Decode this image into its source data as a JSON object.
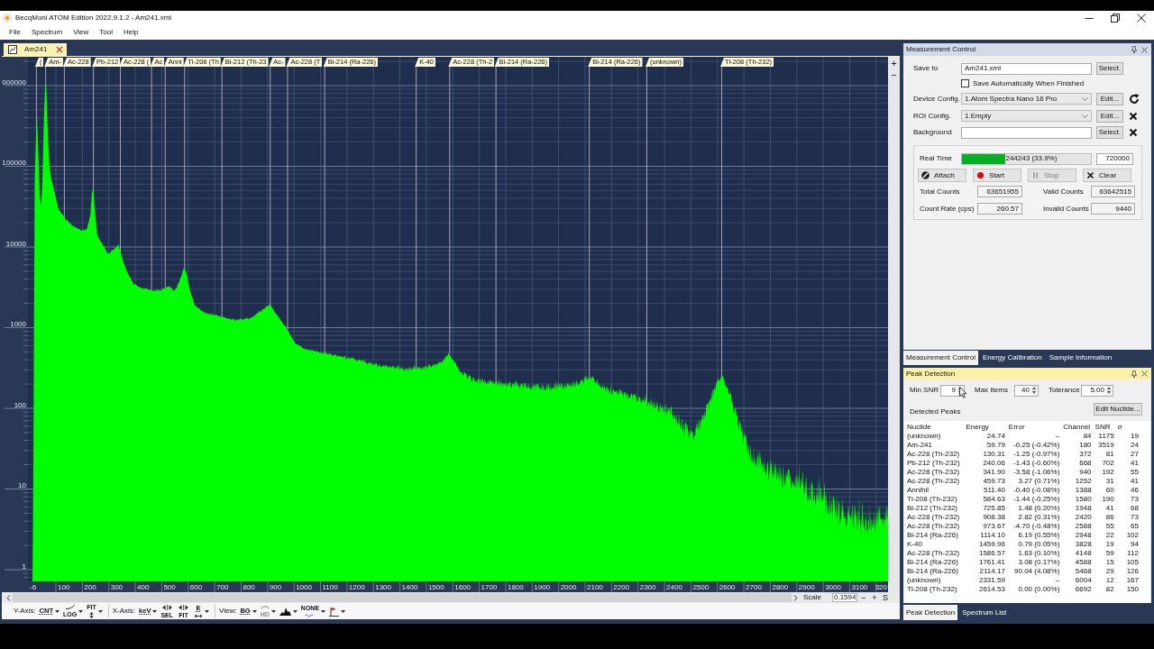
{
  "window": {
    "title": "BecqMoni ATOM Edition 2022.9.1.2 - Am241.xml"
  },
  "menu": [
    "File",
    "Spectrum",
    "View",
    "Tool",
    "Help"
  ],
  "document_tabs": [
    {
      "label": "Am241",
      "selected": true
    }
  ],
  "spectrum": {
    "peak_labels": [
      "(",
      "Am-",
      "Ac-228",
      "Pb-212",
      "Ac-228 (",
      "Ac",
      "Anni",
      "Tl-208 (Th",
      "Bi-212 (Th-23",
      "Ac-",
      "Ac-228 (T",
      "Bi-214 (Ra-226)",
      "K-40",
      "Ac-228 (Th-2",
      "Bi-214 (Ra-226)",
      "Bi-214 (Ra-226)",
      "(unknown)",
      "Tl-208 (Th-232)"
    ],
    "y_axis_labels": [
      "000000",
      "100000",
      "10000",
      "1000",
      "100",
      "10",
      "1"
    ],
    "x_axis_labels": [
      "-6",
      "100",
      "200",
      "300",
      "400",
      "500",
      "600",
      "700",
      "800",
      "900",
      "1000",
      "1100",
      "1200",
      "1300",
      "1400",
      "1500",
      "1600",
      "1700",
      "1800",
      "1900",
      "2000",
      "2100",
      "2200",
      "2300",
      "2400",
      "2500",
      "2600",
      "2700",
      "2800",
      "2900",
      "3000",
      "3100",
      "320"
    ],
    "zoom_buttons": [
      "+",
      "−"
    ]
  },
  "scroll_bar": {
    "scale_label": "Scale",
    "scale_value": "0.1594",
    "buttons": [
      "−",
      "+",
      "S"
    ]
  },
  "chart_toolbar": [
    {
      "label": "Y-Axis:",
      "tools": [
        {
          "kind": "text",
          "text": "CNT",
          "dropdown": true,
          "disabled": false
        },
        {
          "kind": "curve",
          "text": "LOG",
          "dropdown": true,
          "disabled": false
        },
        {
          "kind": "vertical-arrows",
          "text": "FIT",
          "dropdown": true,
          "disabled": false
        }
      ]
    },
    {
      "label": "X-Axis:",
      "tools": [
        {
          "kind": "text",
          "text": "keV",
          "dropdown": true,
          "disabled": false
        },
        {
          "kind": "horizontal-arrows",
          "text": "SEL",
          "dropdown": false,
          "disabled": false
        },
        {
          "kind": "horizontal-arrows",
          "text": "FIT",
          "dropdown": false,
          "disabled": false
        },
        {
          "kind": "over-arrow",
          "text": "E",
          "dropdown": true,
          "disabled": false
        }
      ]
    },
    {
      "label": "View:",
      "tools": [
        {
          "kind": "text",
          "text": "BG",
          "dropdown": true,
          "disabled": false
        },
        {
          "kind": "arc",
          "text": "HD",
          "dropdown": true,
          "disabled": true
        },
        {
          "kind": "mountain",
          "dropdown": true,
          "disabled": false
        },
        {
          "kind": "wave",
          "text": "NONE",
          "dropdown": true,
          "disabled": false
        },
        {
          "kind": "flag",
          "dropdown": true,
          "disabled": false
        }
      ]
    }
  ],
  "measurement_control": {
    "title": "Measurement Control",
    "active": false,
    "rows": [
      {
        "kind": "input",
        "label": "Save to",
        "value": "Am241.xml",
        "button": "Select."
      },
      {
        "kind": "checkbox",
        "label": "Save Automatically When Finished",
        "checked": false
      },
      {
        "kind": "select",
        "label": "Device Config.",
        "value": "1.Atom Spectra Nano 16 Pro",
        "button": "Edit...",
        "side_button": {
          "kind": "reload"
        }
      },
      {
        "kind": "select",
        "label": "ROI Config.",
        "value": "1.Empty",
        "button": "Edit...",
        "side_button": {
          "kind": "remove"
        }
      },
      {
        "kind": "input",
        "label": "Background",
        "button": "Select.",
        "side_button": {
          "kind": "remove"
        }
      }
    ],
    "real_time": {
      "label": "Real Time",
      "level": 0.339,
      "progress_text": "244243 (33.9%)",
      "limit": "720000"
    },
    "buttons": [
      {
        "kind": "attach",
        "label": "Attach",
        "disabled": false
      },
      {
        "kind": "start",
        "label": "Start",
        "disabled": false
      },
      {
        "kind": "stop",
        "label": "Stop",
        "disabled": true
      },
      {
        "kind": "clear",
        "label": "Clear",
        "disabled": false
      }
    ],
    "stats": [
      {
        "label": "Total Counts",
        "value": "63651955"
      },
      {
        "label": "Valid Counts",
        "value": "63642515"
      },
      {
        "label": "Count Rate (cps)",
        "value": "260.57"
      },
      {
        "label": "Invalid Counts",
        "value": "9440"
      }
    ]
  },
  "panel_tabs": [
    {
      "label": "Measurement Control",
      "selected": true
    },
    {
      "label": "Energy Calibration",
      "selected": false
    },
    {
      "label": "Sample Information",
      "selected": false
    }
  ],
  "peak_detection": {
    "title": "Peak Detection",
    "active": true,
    "settings": [
      {
        "label": "Min SNR",
        "value": "9"
      },
      {
        "label": "Max Items",
        "value": "40"
      },
      {
        "label": "Tolerance",
        "value": "5.00"
      }
    ],
    "edit_button": "Edit Nuclide...",
    "list_label": "Detected Peaks",
    "columns": [
      "Nuclide",
      "Energy",
      "Error",
      "Channel",
      "SNR",
      "σ"
    ],
    "rows": [
      [
        "(unknown)",
        "24.74",
        "–",
        "84",
        "1175",
        "19"
      ],
      [
        "Am-241",
        "59.79",
        "-0.25 (-0.42%)",
        "180",
        "3519",
        "24"
      ],
      [
        "Ac-228 (Th-232)",
        "130.31",
        "-1.25 (-0.97%)",
        "372",
        "81",
        "27"
      ],
      [
        "Pb-212 (Th-232)",
        "240.06",
        "-1.43 (-0.60%)",
        "668",
        "702",
        "41"
      ],
      [
        "Ac-228 (Th-232)",
        "341.90",
        "-3.58 (-1.06%)",
        "940",
        "192",
        "55"
      ],
      [
        "Ac-228 (Th-232)",
        "459.73",
        "3.27 (0.71%)",
        "1252",
        "31",
        "41"
      ],
      [
        "Annihil",
        "511.40",
        "-0.40 (-0.08%)",
        "1388",
        "60",
        "46"
      ],
      [
        "Tl-208 (Th-232)",
        "584.63",
        "-1.44 (-0.25%)",
        "1580",
        "190",
        "73"
      ],
      [
        "Bi-212 (Th-232)",
        "725.85",
        "1.48 (0.20%)",
        "1948",
        "41",
        "68"
      ],
      [
        "Ac-228 (Th-232)",
        "908.38",
        "2.82 (0.31%)",
        "2420",
        "86",
        "73"
      ],
      [
        "Ac-228 (Th-232)",
        "973.67",
        "-4.70 (-0.48%)",
        "2588",
        "55",
        "65"
      ],
      [
        "Bi-214 (Ra-226)",
        "1114.10",
        "6.19 (0.55%)",
        "2948",
        "22",
        "102"
      ],
      [
        "K-40",
        "1459.96",
        "0.79 (0.05%)",
        "3828",
        "19",
        "94"
      ],
      [
        "Ac-228 (Th-232)",
        "1586.57",
        "1.63 (0.10%)",
        "4148",
        "59",
        "112"
      ],
      [
        "Bi-214 (Ra-226)",
        "1761.41",
        "3.08 (0.17%)",
        "4588",
        "15",
        "105"
      ],
      [
        "Bi-214 (Ra-226)",
        "2114.17",
        "90.04 (4.08%)",
        "5468",
        "29",
        "126"
      ],
      [
        "(unknown)",
        "2331.59",
        "–",
        "6004",
        "12",
        "167"
      ],
      [
        "Tl-208 (Th-232)",
        "2614.53",
        "0.00 (0.00%)",
        "6692",
        "82",
        "150"
      ]
    ]
  },
  "bottom_tabs": [
    {
      "label": "Peak Detection",
      "selected": true
    },
    {
      "label": "Spectrum List",
      "selected": false
    }
  ]
}
